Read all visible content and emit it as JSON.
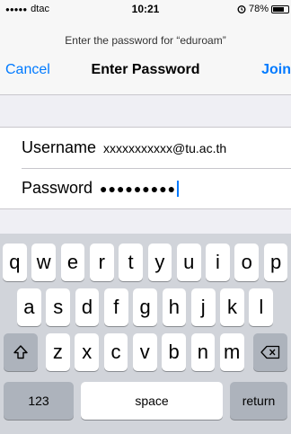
{
  "status_bar": {
    "carrier_signal": "●●●●●",
    "carrier": "dtac",
    "time": "10:21",
    "battery_percent": "78%",
    "battery_level": 0.78
  },
  "prompt": "Enter the password for “eduroam”",
  "nav": {
    "cancel": "Cancel",
    "title": "Enter Password",
    "join": "Join"
  },
  "form": {
    "username_label": "Username",
    "username_value": "xxxxxxxxxxx@tu.ac.th",
    "password_label": "Password",
    "password_value": "●●●●●●●●●"
  },
  "keyboard": {
    "row1": [
      "q",
      "w",
      "e",
      "r",
      "t",
      "y",
      "u",
      "i",
      "o",
      "p"
    ],
    "row2": [
      "a",
      "s",
      "d",
      "f",
      "g",
      "h",
      "j",
      "k",
      "l"
    ],
    "row3": [
      "z",
      "x",
      "c",
      "v",
      "b",
      "n",
      "m"
    ],
    "numbers": "123",
    "space": "space",
    "return": "return",
    "shift_icon": "shift-icon",
    "delete_icon": "delete-icon"
  }
}
